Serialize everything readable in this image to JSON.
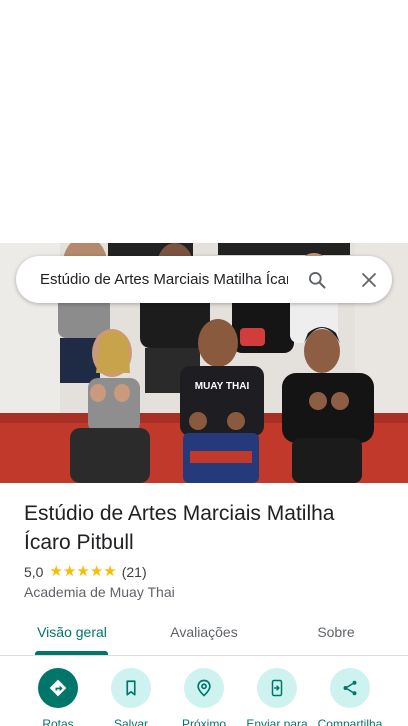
{
  "search": {
    "query": "Estúdio de Artes Marciais Matilha Ícaro Pitbull"
  },
  "place": {
    "name": "Estúdio de Artes Marciais Matilha Ícaro Pitbull",
    "rating": "5,0",
    "stars": 5,
    "review_count": "(21)",
    "category": "Academia de Muay Thai"
  },
  "hero": {
    "shirt_text": "MUAY THAI"
  },
  "tabs": [
    {
      "label": "Visão geral",
      "active": true
    },
    {
      "label": "Avaliações",
      "active": false
    },
    {
      "label": "Sobre",
      "active": false
    }
  ],
  "actions": [
    {
      "label": "Rotas",
      "icon": "directions-icon"
    },
    {
      "label": "Salvar",
      "icon": "bookmark-icon"
    },
    {
      "label": "Próximo",
      "icon": "nearby-icon"
    },
    {
      "label": "Enviar para",
      "icon": "send-to-phone-icon"
    },
    {
      "label": "Compartilha",
      "icon": "share-icon"
    }
  ],
  "colors": {
    "accent": "#00756a",
    "accent_light": "#cdf2f0",
    "star": "#fbbc04"
  }
}
